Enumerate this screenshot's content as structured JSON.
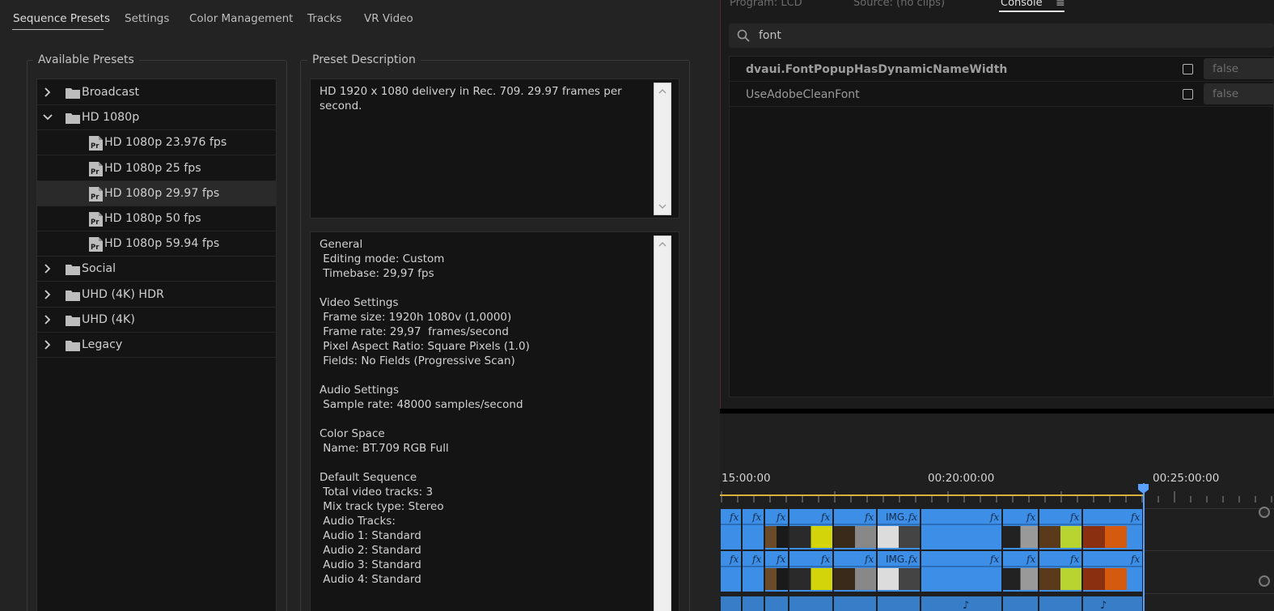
{
  "dialog": {
    "tabs": [
      {
        "label": "Sequence Presets"
      },
      {
        "label": "Settings"
      },
      {
        "label": "Color Management"
      },
      {
        "label": "Tracks"
      },
      {
        "label": "VR Video"
      }
    ],
    "presets_title": "Available Presets",
    "description_title": "Preset Description",
    "tree": [
      {
        "label": "Broadcast",
        "type": "folder",
        "expanded": false
      },
      {
        "label": "HD 1080p",
        "type": "folder",
        "expanded": true
      },
      {
        "label": "HD 1080p 23.976 fps",
        "type": "preset"
      },
      {
        "label": "HD 1080p 25 fps",
        "type": "preset"
      },
      {
        "label": "HD 1080p 29.97 fps",
        "type": "preset",
        "selected": true
      },
      {
        "label": "HD 1080p 50 fps",
        "type": "preset"
      },
      {
        "label": "HD 1080p 59.94 fps",
        "type": "preset"
      },
      {
        "label": "Social",
        "type": "folder",
        "expanded": false
      },
      {
        "label": "UHD (4K) HDR",
        "type": "folder",
        "expanded": false
      },
      {
        "label": "UHD (4K)",
        "type": "folder",
        "expanded": false
      },
      {
        "label": "Legacy",
        "type": "folder",
        "expanded": false
      }
    ],
    "description": "HD 1920 x 1080 delivery in Rec. 709. 29.97 frames per second.",
    "details": [
      "General",
      " Editing mode: Custom",
      " Timebase: 29,97 fps",
      "",
      "Video Settings",
      " Frame size: 1920h 1080v (1,0000)",
      " Frame rate: 29,97  frames/second",
      " Pixel Aspect Ratio: Square Pixels (1.0)",
      " Fields: No Fields (Progressive Scan)",
      "",
      "Audio Settings",
      " Sample rate: 48000 samples/second",
      "",
      "Color Space",
      " Name: BT.709 RGB Full",
      "",
      "Default Sequence",
      " Total video tracks: 3",
      " Mix track type: Stereo",
      " Audio Tracks:",
      " Audio 1: Standard",
      " Audio 2: Standard",
      " Audio 3: Standard",
      " Audio 4: Standard"
    ]
  },
  "panel": {
    "tabs": [
      {
        "label": "Program: LCD"
      },
      {
        "label": "Source: (no clips)"
      },
      {
        "label": "Console"
      }
    ],
    "search": {
      "value": "font"
    },
    "rows": [
      {
        "name": "dvaui.FontPopupHasDynamicNameWidth",
        "value": "false",
        "bold": true
      },
      {
        "name": "UseAdobeCleanFont",
        "value": "false",
        "bold": false
      }
    ]
  },
  "timeline": {
    "timecodes": [
      "15:00:00",
      "00:20:00:00",
      "00:25:00:00"
    ],
    "clip_label": "IMG...",
    "fx_label": "fx"
  },
  "colors": {
    "clip_blue": "#3d8ee6",
    "playhead": "#5aa0ff",
    "workarea": "#d9b23c"
  }
}
